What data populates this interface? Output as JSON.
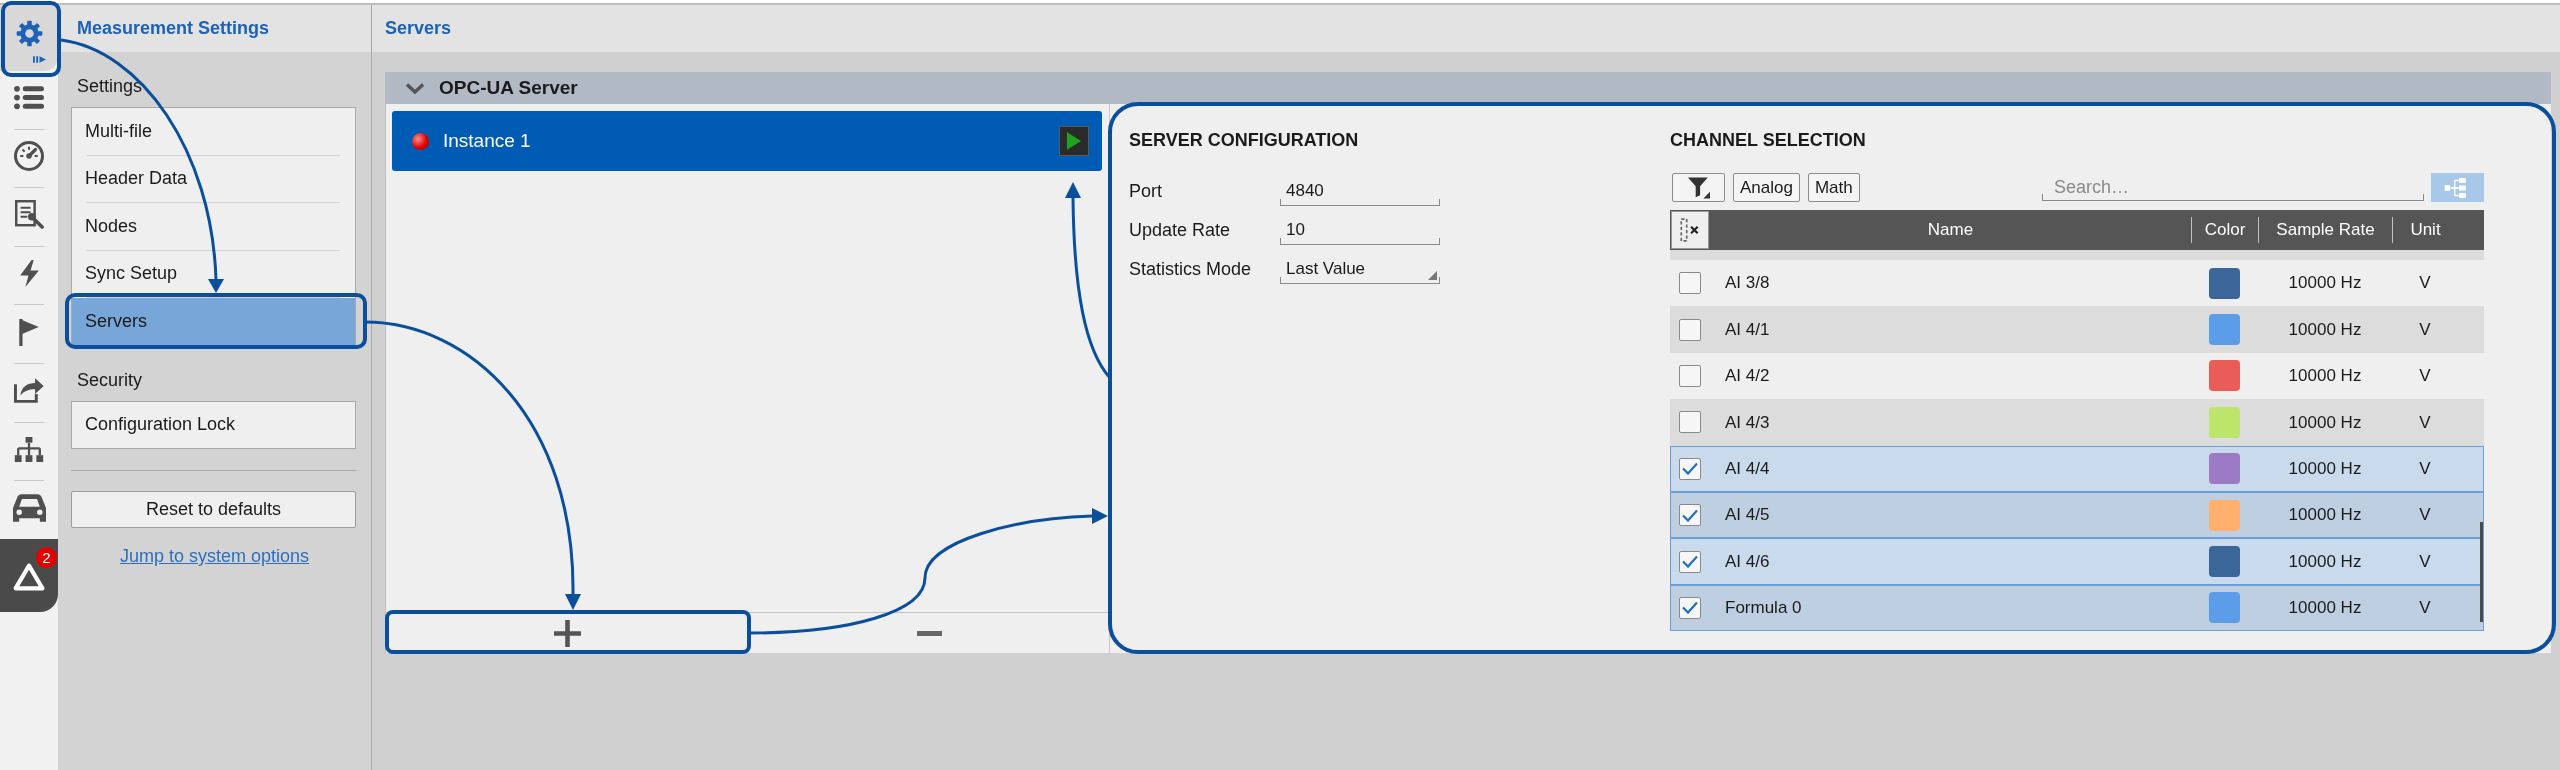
{
  "nav_rail": [
    {
      "selected": true
    },
    {
      "selected": false
    },
    {
      "selected": false
    },
    {
      "selected": false
    },
    {
      "selected": false
    },
    {
      "selected": false
    },
    {
      "selected": false
    },
    {
      "selected": false
    },
    {
      "selected": false
    },
    {
      "selected": false,
      "badge": "2"
    }
  ],
  "sidebar": {
    "title": "Measurement Settings",
    "sections": [
      {
        "heading": "Settings",
        "items": [
          {
            "label": "Multi-file",
            "selected": false
          },
          {
            "label": "Header Data",
            "selected": false
          },
          {
            "label": "Nodes",
            "selected": false
          },
          {
            "label": "Sync Setup",
            "selected": false
          },
          {
            "label": "Servers",
            "selected": true
          }
        ]
      },
      {
        "heading": "Security",
        "items": [
          {
            "label": "Configuration Lock",
            "selected": false
          }
        ]
      }
    ],
    "reset_button": "Reset to defaults",
    "link": "Jump to system options"
  },
  "page_title": "Servers",
  "section": {
    "title": "OPC-UA Server",
    "expanded": true
  },
  "instances": [
    {
      "label": "Instance 1",
      "selected": true,
      "running": false
    }
  ],
  "server_configuration": {
    "heading": "SERVER CONFIGURATION",
    "fields": [
      {
        "label": "Port",
        "value": "4840",
        "kind": "text"
      },
      {
        "label": "Update Rate",
        "value": "10",
        "kind": "text"
      },
      {
        "label": "Statistics Mode",
        "value": "Last Value",
        "kind": "dropdown"
      }
    ]
  },
  "channel_selection": {
    "heading": "CHANNEL SELECTION",
    "filter_buttons": [
      "Analog",
      "Math"
    ],
    "search": {
      "placeholder": "Search…"
    },
    "columns": [
      "Name",
      "Color",
      "Sample Rate",
      "Unit"
    ],
    "rows": [
      {
        "name": "AI 3/8",
        "checked": false,
        "color": "#3b6699",
        "sample_rate": "10000 Hz",
        "unit": "V"
      },
      {
        "name": "AI 4/1",
        "checked": false,
        "color": "#5b9de8",
        "sample_rate": "10000 Hz",
        "unit": "V"
      },
      {
        "name": "AI 4/2",
        "checked": false,
        "color": "#e95c57",
        "sample_rate": "10000 Hz",
        "unit": "V"
      },
      {
        "name": "AI 4/3",
        "checked": false,
        "color": "#bde46b",
        "sample_rate": "10000 Hz",
        "unit": "V"
      },
      {
        "name": "AI 4/4",
        "checked": true,
        "color": "#9c7ac6",
        "sample_rate": "10000 Hz",
        "unit": "V"
      },
      {
        "name": "AI 4/5",
        "checked": true,
        "color": "#ffb06f",
        "sample_rate": "10000 Hz",
        "unit": "V"
      },
      {
        "name": "AI 4/6",
        "checked": true,
        "color": "#3b6699",
        "sample_rate": "10000 Hz",
        "unit": "V"
      },
      {
        "name": "Formula 0",
        "checked": true,
        "color": "#5b9de8",
        "sample_rate": "10000 Hz",
        "unit": "V"
      }
    ]
  }
}
